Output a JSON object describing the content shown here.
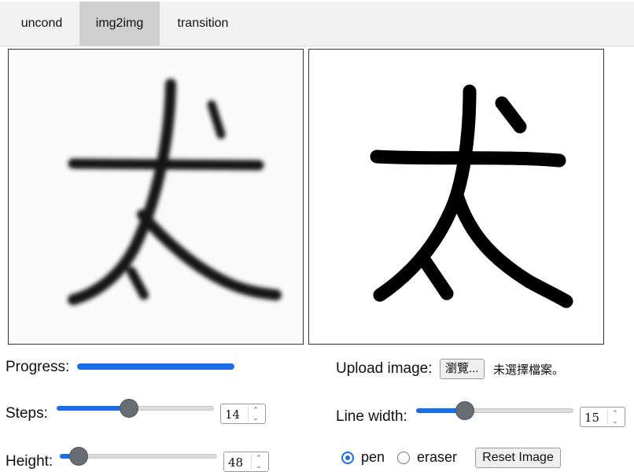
{
  "tabs": [
    {
      "label": "uncond",
      "active": false
    },
    {
      "label": "img2img",
      "active": true
    },
    {
      "label": "transition",
      "active": false
    }
  ],
  "left_panel": {
    "content": "generated-character-image"
  },
  "right_panel": {
    "content": "drawn-character-canvas"
  },
  "progress": {
    "label": "Progress:",
    "value": 1.0
  },
  "steps": {
    "label": "Steps:",
    "value": "14",
    "slider_fraction": 0.46
  },
  "height": {
    "label": "Height:",
    "value": "48",
    "slider_fraction": 0.12
  },
  "upload": {
    "label": "Upload image:",
    "button": "瀏覽...",
    "status": "未選擇檔案。"
  },
  "line_width": {
    "label": "Line width:",
    "value": "15",
    "slider_fraction": 0.31
  },
  "tool": {
    "pen_label": "pen",
    "eraser_label": "eraser",
    "selected": "pen"
  },
  "reset_label": "Reset Image",
  "colors": {
    "accent": "#1a6ee8",
    "thumb": "#666d73",
    "tab_active": "#cfcfcf"
  },
  "icons": {
    "spinner": "spinner-arrows-icon"
  }
}
